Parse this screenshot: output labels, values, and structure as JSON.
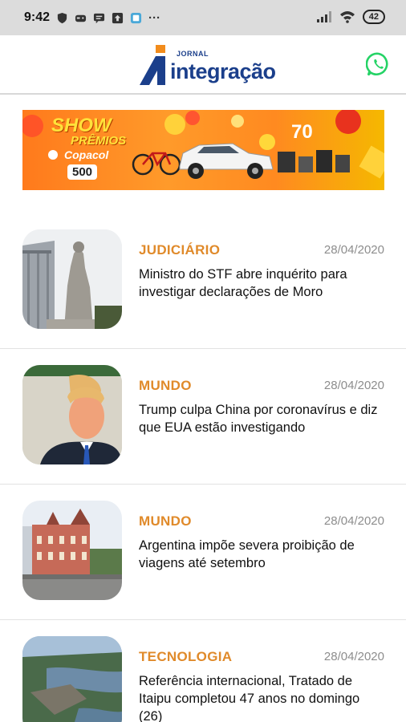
{
  "status_bar": {
    "time": "9:42",
    "battery": "42"
  },
  "header": {
    "logo_small": "JORNAL",
    "logo_main": "integração"
  },
  "banner": {
    "headline": "SHOW",
    "subheadline": "PRÊMIOS",
    "brand": "Copacol",
    "badge": "500",
    "prize_count": "70"
  },
  "news": [
    {
      "category": "JUDICIÁRIO",
      "date": "28/04/2020",
      "title": "Ministro do STF abre inquérito para investigar declarações de Moro",
      "thumb": "statue"
    },
    {
      "category": "MUNDO",
      "date": "28/04/2020",
      "title": "Trump culpa China por coronavírus e diz que EUA estão investigando",
      "thumb": "portrait"
    },
    {
      "category": "MUNDO",
      "date": "28/04/2020",
      "title": "Argentina impõe severa proibição de viagens até setembro",
      "thumb": "building"
    },
    {
      "category": "TECNOLOGIA",
      "date": "28/04/2020",
      "title": "Referência internacional, Tratado de Itaipu completou 47 anos no domingo (26)",
      "thumb": "dam"
    }
  ],
  "colors": {
    "category": "#e08a2a",
    "brand_blue": "#1b3f8b",
    "whatsapp": "#25d366"
  }
}
